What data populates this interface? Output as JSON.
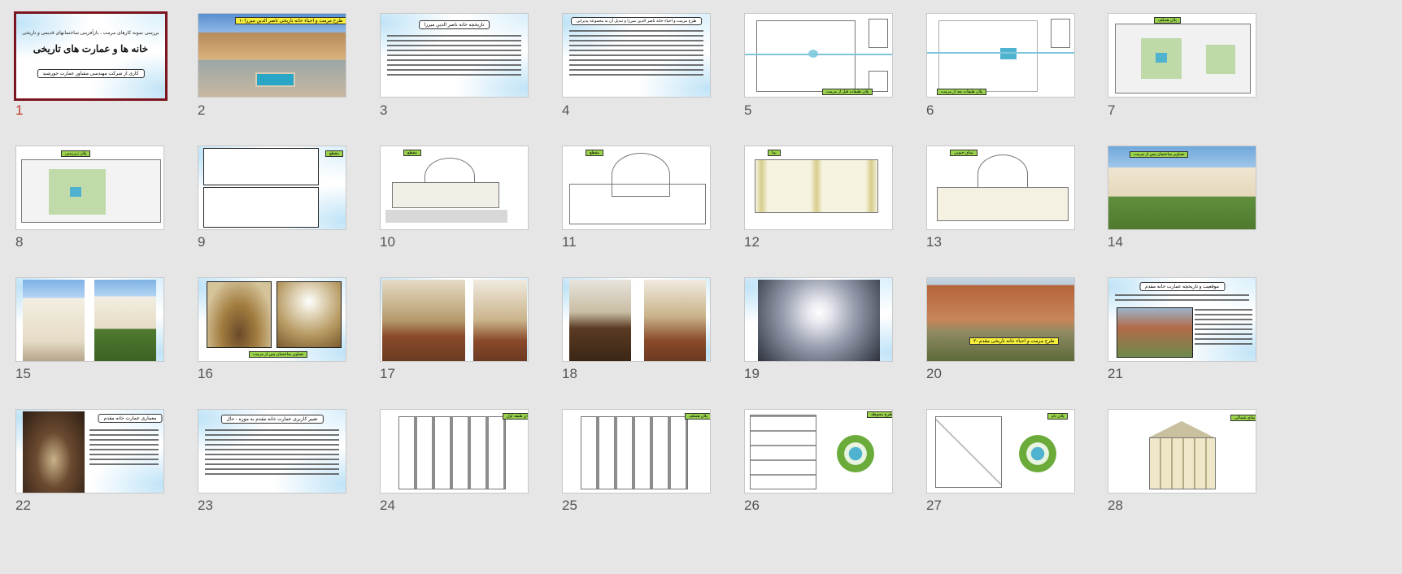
{
  "slides": [
    {
      "number": "1",
      "title_small": "بررسی نمونه کارهای مرمت ، بازآفرینی ساختمانهای قدیمی و تاریخی",
      "title_big": "خانه ها و عمارت های تاریخی",
      "subtitle": "کاری از شرکت مهندسی مشاور عمارت خورشید"
    },
    {
      "number": "2",
      "label": "۱- طرح مرمت و احیاء خانه تاریخی ناصر الدین میرزا"
    },
    {
      "number": "3",
      "label": "تاریخچه خانه ناصر الدین میرزا"
    },
    {
      "number": "4",
      "label": "طرح مرمت و احیاء خانه ناصر الدین میرزا و تبدیل آن به مجموعه پذیرایی"
    },
    {
      "number": "5",
      "label": "پلان طبقات قبل از مرمت"
    },
    {
      "number": "6",
      "label": "پلان طبقات بعد از مرمت"
    },
    {
      "number": "7",
      "label": "پلان همکف"
    },
    {
      "number": "8",
      "label": "پلان زیرزمین"
    },
    {
      "number": "9",
      "label": "مقطع"
    },
    {
      "number": "10",
      "label": "مقطع"
    },
    {
      "number": "11",
      "label": "مقطع"
    },
    {
      "number": "12",
      "label": "نما"
    },
    {
      "number": "13",
      "label": "نمای جنوبی"
    },
    {
      "number": "14",
      "label": "تصاویر ساختمان پس از مرمت"
    },
    {
      "number": "15"
    },
    {
      "number": "16",
      "label": "تصاویر ساختمان پس از مرمت"
    },
    {
      "number": "17"
    },
    {
      "number": "18"
    },
    {
      "number": "19"
    },
    {
      "number": "20",
      "label": "۲- طرح مرمت و احیاء خانه تاریخی مقدم"
    },
    {
      "number": "21",
      "label": "موقعیت و تاریخچه عمارت خانه مقدم"
    },
    {
      "number": "22",
      "label": "معماری عمارت خانه مقدم"
    },
    {
      "number": "23",
      "label": "تغییر کاربری عمارت خانه مقدم به موزه - حال"
    },
    {
      "number": "24",
      "label": "پلان طبقه اول"
    },
    {
      "number": "25",
      "label": "پلان همکف"
    },
    {
      "number": "26",
      "label": "طرح محوطه"
    },
    {
      "number": "27",
      "label": "پلان بام"
    },
    {
      "number": "28",
      "label": "نمای شمالی"
    }
  ],
  "colors": {
    "selection": "#7b1520",
    "selected_number": "#c0392b",
    "background": "#e6e6e6"
  }
}
